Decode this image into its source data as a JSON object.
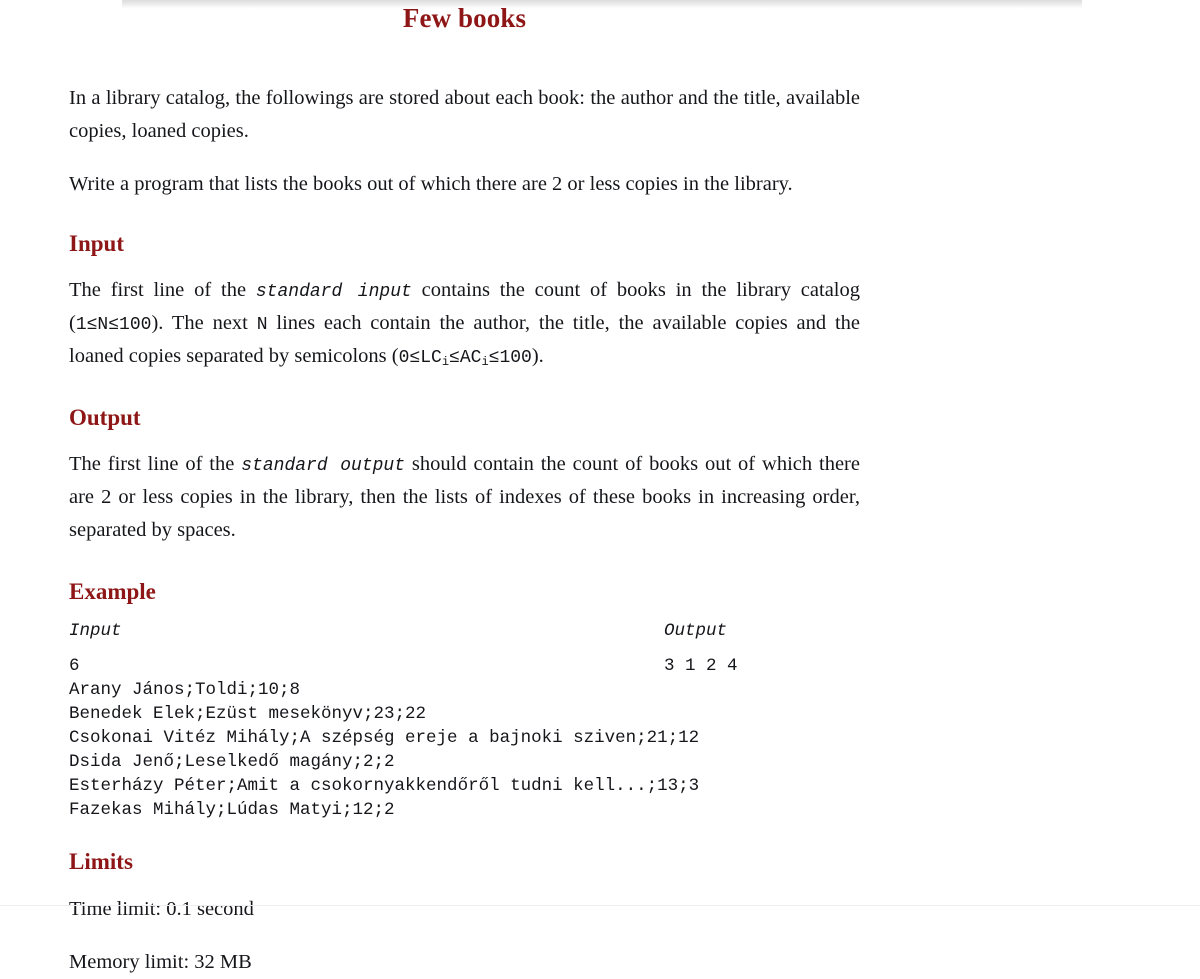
{
  "document": {
    "title": "Few books",
    "paragraphs": {
      "intro": "In a library catalog, the followings are stored about each book: the author and the title, available copies, loaned copies.",
      "task": "Write a program that lists the books out of which there are 2 or less copies in the library."
    },
    "sections": {
      "input": {
        "heading": "Input",
        "text_part1": "The first line of the ",
        "code_stream": "standard input",
        "text_part2": " contains the count of books in the library catalog (",
        "code_n_range": "1≤N≤100",
        "text_part3": "). The next ",
        "code_n": "N",
        "text_part4": " lines each contain the author, the title, the available copies and the loaned copies separated by semicolons (",
        "code_constraint_pre": "0≤LC",
        "code_constraint_sub1": "i",
        "code_constraint_mid": "≤AC",
        "code_constraint_sub2": "i",
        "code_constraint_post": "≤100",
        "text_part5": ")."
      },
      "output": {
        "heading": "Output",
        "text_part1": "The first line of the ",
        "code_stream": "standard output",
        "text_part2": " should contain the count of books out of which there are 2 or less copies in the library, then the lists of indexes of these books in increasing order, separated by spaces."
      },
      "example": {
        "heading": "Example",
        "input_label": "Input",
        "output_label": "Output",
        "input_lines": [
          "6",
          "Arany János;Toldi;10;8",
          "Benedek Elek;Ezüst mesekönyv;23;22",
          "Csokonai Vitéz Mihály;A szépség ereje a bajnoki sziven;21;12",
          "Dsida Jenő;Leselkedő magány;2;2",
          "Esterházy Péter;Amit a csokornyakkendőről tudni kell...;13;3",
          "Fazekas Mihály;Lúdas Matyi;12;2"
        ],
        "output_lines": [
          "3 1 2 4"
        ]
      },
      "limits": {
        "heading": "Limits",
        "time_limit": "Time limit: 0.1 second",
        "memory_limit": "Memory limit: 32 MB"
      }
    },
    "colors": {
      "heading": "#8e1616",
      "body_text": "#15161a",
      "page_background": "#ffffff",
      "rule": "#ededed"
    }
  }
}
